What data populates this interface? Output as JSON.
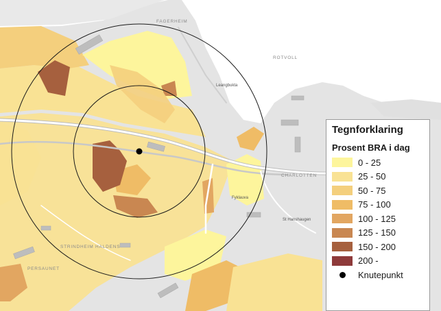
{
  "legend": {
    "title": "Tegnforklaring",
    "subtitle": "Prosent BRA i dag",
    "classes": [
      {
        "label": "0 - 25",
        "color": "#fdf59c"
      },
      {
        "label": "25 - 50",
        "color": "#f9e294"
      },
      {
        "label": "50 - 75",
        "color": "#f4cf7d"
      },
      {
        "label": "75 - 100",
        "color": "#efbc66"
      },
      {
        "label": "100 - 125",
        "color": "#e2a661"
      },
      {
        "label": "125 - 150",
        "color": "#c98751"
      },
      {
        "label": "150 - 200",
        "color": "#a6603e"
      },
      {
        "label": "200 -",
        "color": "#8e3a3a"
      }
    ],
    "node_label": "Knutepunkt"
  },
  "places": {
    "fagerheim": "FAGERHEIM",
    "rotvoll": "ROTVOLL",
    "charlottenlund": "CHARLOTTEN",
    "persaunet": "PERSAUNET",
    "strindheim_haldens": "STRINDHEIM HALDENS",
    "leangbukta": "Leangbukta",
    "st_hanshaugen": "St Hanshaugen",
    "fyklauva": "Fyklauva"
  }
}
